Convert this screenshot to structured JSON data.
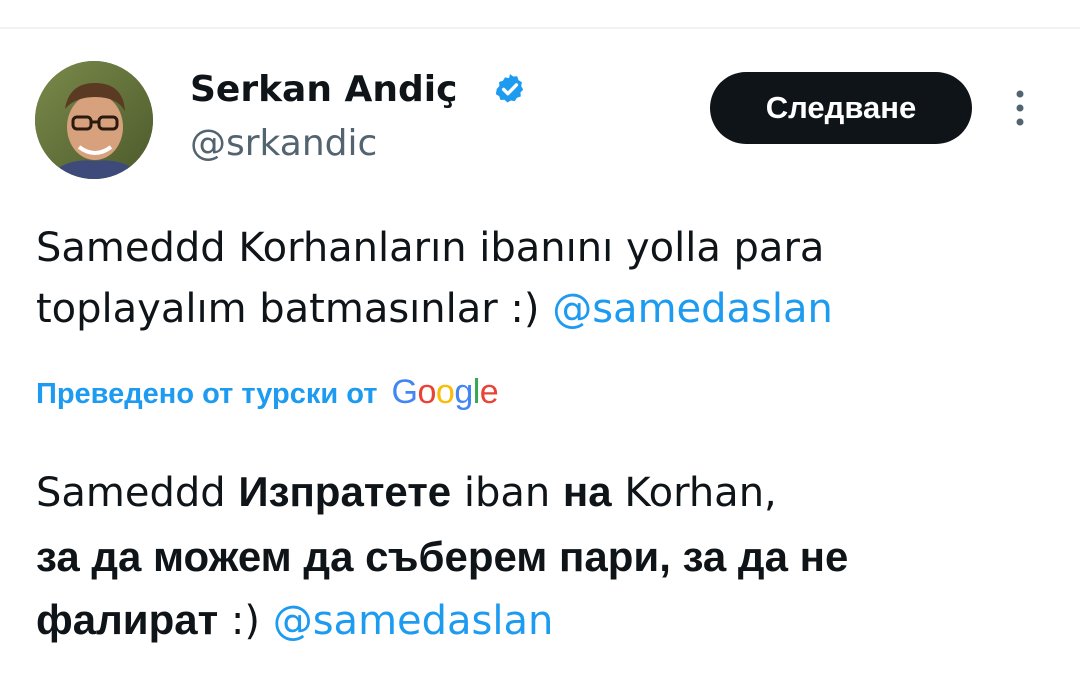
{
  "author": {
    "name": "Serkan Andiç",
    "handle": "@srkandic",
    "verified_icon": "verified-badge-icon"
  },
  "actions": {
    "follow_label": "Следване",
    "more_icon": "more-vertical-icon"
  },
  "tweet": {
    "line1": "Sameddd Korhanların ibanını yolla para",
    "line2_text": "toplayalım batmasınlar :) ",
    "mention": "@samedaslan"
  },
  "translation": {
    "label": "Преведено от турски от",
    "provider": "Google",
    "t1": "Sameddd ",
    "t2": "Изпратете",
    "t3": " iban ",
    "t4": "на",
    "t5": " Korhan,",
    "line2": "за да можем да съберем пари, за да не",
    "line3_bold": "фалират",
    "line3_text": " :) ",
    "mention": "@samedaslan"
  },
  "colors": {
    "accent": "#1d9bf0",
    "button_bg": "#0f1419",
    "secondary_text": "#536471"
  }
}
